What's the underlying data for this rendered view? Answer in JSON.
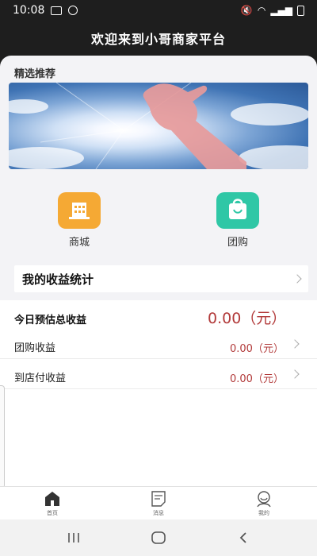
{
  "status_bar": {
    "time": "10:08"
  },
  "header": {
    "title": "欢迎来到小哥商家平台"
  },
  "featured": {
    "title": "精选推荐"
  },
  "quick_links": [
    {
      "label": "商城",
      "icon": "building-icon",
      "color": "#f5a934"
    },
    {
      "label": "团购",
      "icon": "shopping-bag-icon",
      "color": "#2fc7a6"
    }
  ],
  "stats": {
    "title": "我的收益统计",
    "total_label": "今日预估总收益",
    "total_value": "0.00（元）",
    "rows": [
      {
        "label": "团购收益",
        "value": "0.00（元）"
      },
      {
        "label": "到店付收益",
        "value": "0.00（元）"
      }
    ]
  },
  "tabs": [
    {
      "label": "首页",
      "icon": "home-icon"
    },
    {
      "label": "消息",
      "icon": "message-icon"
    },
    {
      "label": "我的",
      "icon": "profile-icon"
    }
  ],
  "colors": {
    "accent_red": "#b23a3a",
    "mall_orange": "#f5a934",
    "group_teal": "#2fc7a6"
  }
}
